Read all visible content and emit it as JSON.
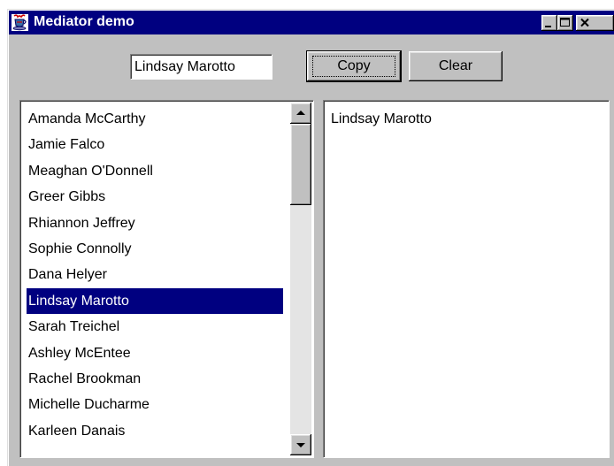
{
  "window": {
    "title": "Mediator demo"
  },
  "colors": {
    "titlebar": "#000080",
    "window_bg": "#c0c0c0",
    "selection": "#000080",
    "selection_text": "#ffffff",
    "list_bg": "#ffffff"
  },
  "icons": {
    "app": "java-cup-icon",
    "minimize": "minimize-icon",
    "maximize": "maximize-icon",
    "close": "close-icon",
    "scroll_up": "arrow-up-icon",
    "scroll_down": "arrow-down-icon"
  },
  "toolbar": {
    "name_field_value": "Lindsay Marotto",
    "copy_label": "Copy",
    "clear_label": "Clear"
  },
  "name_list": {
    "items": [
      "Amanda McCarthy",
      "Jamie Falco",
      "Meaghan O'Donnell",
      "Greer Gibbs",
      "Rhiannon Jeffrey",
      "Sophie Connolly",
      "Dana Helyer",
      "Lindsay Marotto",
      "Sarah Treichel",
      "Ashley McEntee",
      "Rachel Brookman",
      "Michelle Ducharme",
      "Karleen Danais"
    ],
    "selected_index": 7,
    "scroll_position": 0.0
  },
  "copy_list": {
    "items": [
      "Lindsay Marotto"
    ]
  }
}
